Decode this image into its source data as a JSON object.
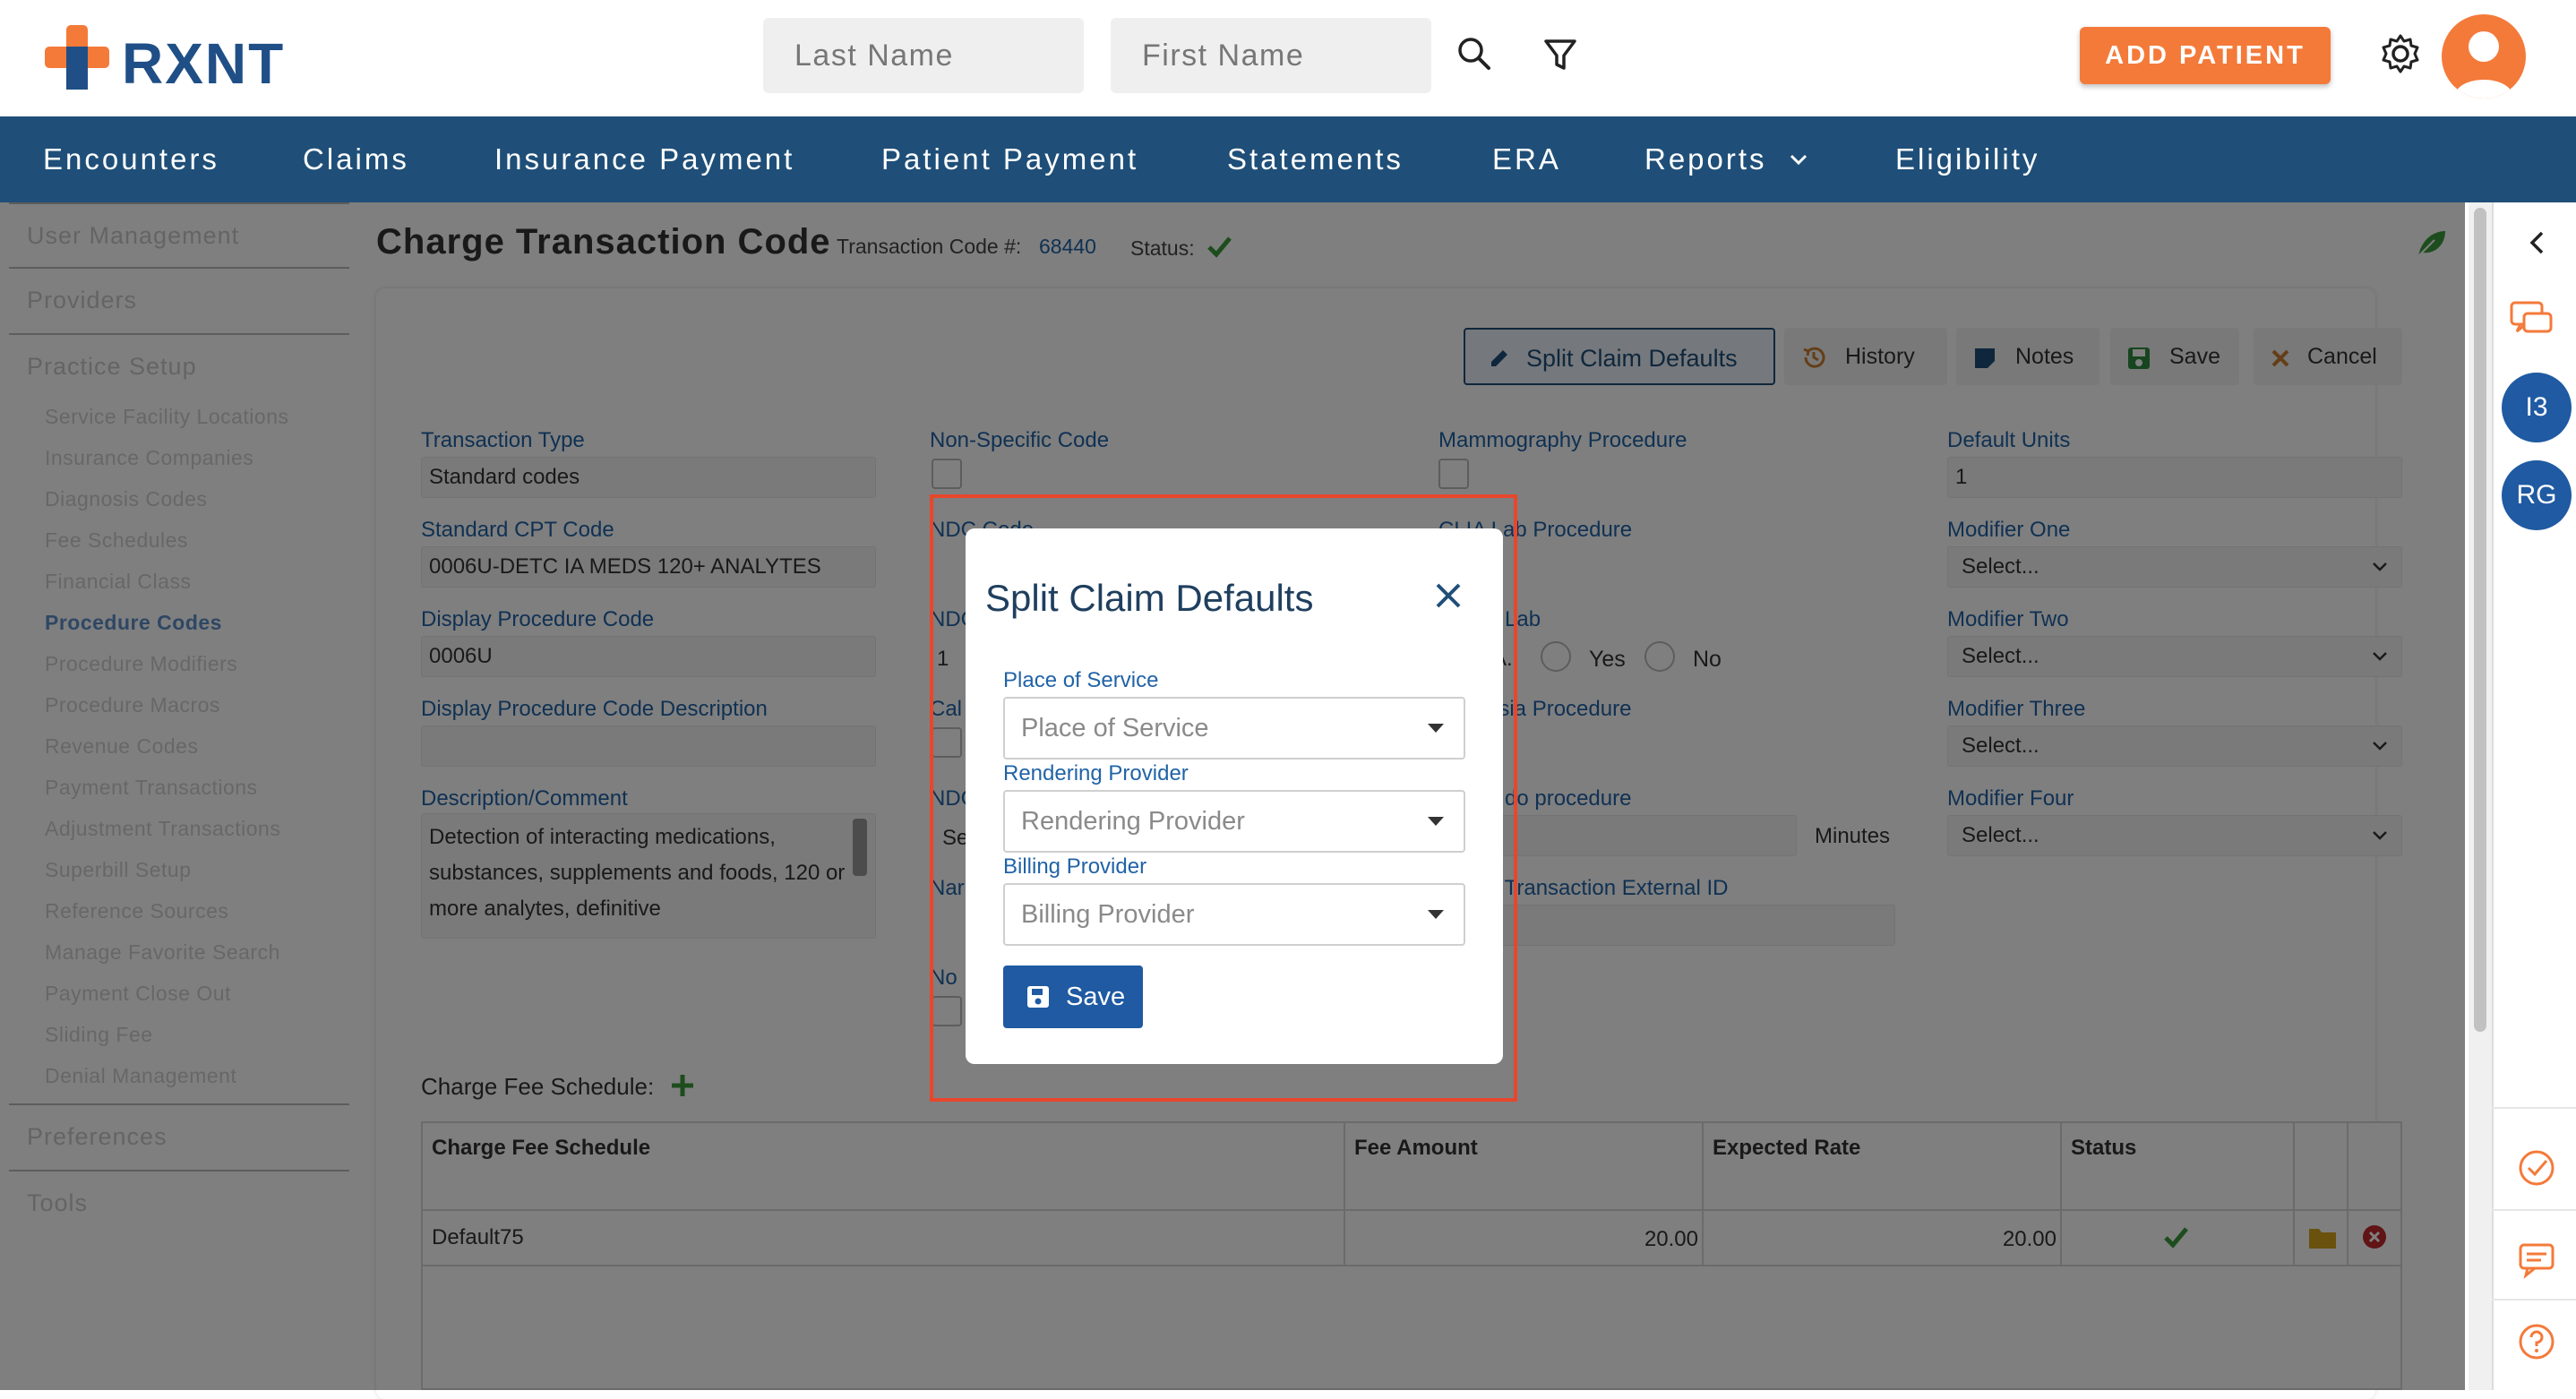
{
  "header": {
    "logo_text": "RXNT",
    "last_name_placeholder": "Last Name",
    "first_name_placeholder": "First Name",
    "add_patient_label": "ADD PATIENT"
  },
  "nav": {
    "items": [
      "Encounters",
      "Claims",
      "Insurance Payment",
      "Patient Payment",
      "Statements",
      "ERA",
      "Reports",
      "Eligibility"
    ]
  },
  "sidebar": {
    "sections": [
      "User Management",
      "Providers",
      "Practice Setup",
      "Preferences",
      "Tools"
    ],
    "items": [
      "Service Facility Locations",
      "Insurance Companies",
      "Diagnosis Codes",
      "Fee Schedules",
      "Financial Class",
      "Procedure Codes",
      "Procedure Modifiers",
      "Procedure Macros",
      "Revenue Codes",
      "Payment Transactions",
      "Adjustment Transactions",
      "Superbill Setup",
      "Reference Sources",
      "Manage Favorite Search",
      "Payment Close Out",
      "Sliding Fee",
      "Denial Management"
    ],
    "active_item": "Procedure Codes"
  },
  "page": {
    "title": "Charge Transaction Code",
    "transaction_code_label": "Transaction Code #:",
    "transaction_code_value": "68440",
    "status_label": "Status:"
  },
  "toolbar": {
    "split_claim_defaults": "Split Claim Defaults",
    "history": "History",
    "notes": "Notes",
    "save": "Save",
    "cancel": "Cancel"
  },
  "form": {
    "transaction_type_label": "Transaction Type",
    "transaction_type_value": "Standard codes",
    "standard_cpt_label": "Standard CPT Code",
    "standard_cpt_value": "0006U-DETC IA MEDS 120+ ANALYTES",
    "display_code_label": "Display Procedure Code",
    "display_code_value": "0006U",
    "display_desc_label": "Display Procedure Code Description",
    "description_label": "Description/Comment",
    "description_value": "Detection of interacting medications, substances, supplements and foods, 120 or more analytes, definitive",
    "non_specific_label": "Non-Specific Code",
    "ndc_code_label_partial": "NDC Code",
    "ndc_partial_2": "NDC",
    "ndc_value_partial": "1",
    "cal_partial": "Cal",
    "ndc_partial_3": "NDC",
    "se_partial": "Se",
    "nar_partial": "Nar",
    "no_partial": "No",
    "mammography_label": "Mammography Procedure",
    "clia_partial": "CLIA Lab Procedure",
    "lab_partial": "e Lab",
    "a_partial": "A.",
    "yes_label": "Yes",
    "no_label": "No",
    "anesthesia_partial": "esia Procedure",
    "todo_partial": "o do procedure",
    "minutes_label": "Minutes",
    "external_partial": "e Transaction External ID",
    "default_units_label": "Default Units",
    "default_units_value": "1",
    "modifier_one_label": "Modifier One",
    "modifier_two_label": "Modifier Two",
    "modifier_three_label": "Modifier Three",
    "modifier_four_label": "Modifier Four",
    "select_placeholder": "Select..."
  },
  "fee_schedule": {
    "title": "Charge Fee Schedule:",
    "columns": [
      "Charge Fee Schedule",
      "Fee Amount",
      "Expected Rate",
      "Status"
    ],
    "rows": [
      {
        "name": "Default75",
        "fee": "20.00",
        "expected": "20.00"
      }
    ]
  },
  "rail": {
    "badges": [
      "I3",
      "RG"
    ]
  },
  "modal": {
    "title": "Split Claim Defaults",
    "pos_label": "Place of Service",
    "pos_placeholder": "Place of Service",
    "rendering_label": "Rendering Provider",
    "rendering_placeholder": "Rendering Provider",
    "billing_label": "Billing Provider",
    "billing_placeholder": "Billing Provider",
    "save_label": "Save"
  },
  "colors": {
    "brand_blue": "#1f4f78",
    "accent_orange": "#f47a3a",
    "link_blue": "#2063a7",
    "highlight_red": "#e8462b",
    "status_green": "#3a9a3a"
  }
}
